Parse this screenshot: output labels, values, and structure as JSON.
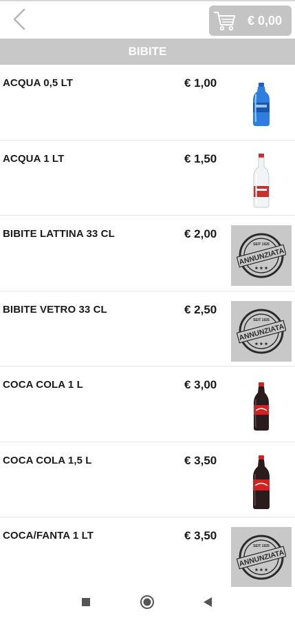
{
  "header": {
    "back_icon": "chevron-left-icon",
    "cart_icon": "shopping-cart-icon",
    "cart_total": "€ 0,00"
  },
  "category": {
    "title": "BIBITE"
  },
  "products": [
    {
      "name": "ACQUA 0,5 LT",
      "price": "€ 1,00",
      "image": "blue-water-bottle"
    },
    {
      "name": "ACQUA 1 LT",
      "price": "€ 1,50",
      "image": "glass-water-bottle"
    },
    {
      "name": "BIBITE LATTINA 33 CL",
      "price": "€ 2,00",
      "image": "annunziata-stamp",
      "stamp_text": "ANNUNZIATA"
    },
    {
      "name": "BIBITE VETRO 33 CL",
      "price": "€ 2,50",
      "image": "annunziata-stamp",
      "stamp_text": "ANNUNZIATA"
    },
    {
      "name": "COCA COLA 1 L",
      "price": "€ 3,00",
      "image": "cola-bottle"
    },
    {
      "name": "COCA COLA 1,5 L",
      "price": "€ 3,50",
      "image": "cola-bottle"
    },
    {
      "name": "COCA/FANTA 1 LT",
      "price": "€ 3,50",
      "image": "annunziata-stamp",
      "stamp_text": "ANNUNZIATA"
    }
  ],
  "navigation": {
    "recents_icon": "square-icon",
    "home_icon": "circle-icon",
    "back_icon": "triangle-back-icon"
  },
  "colors": {
    "header_grey": "#c8c8c8",
    "cart_button": "#c4c4c4",
    "text": "#1a1a1a"
  }
}
